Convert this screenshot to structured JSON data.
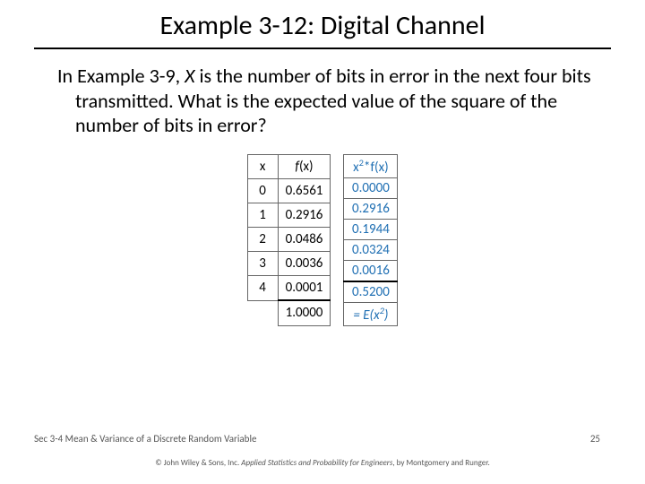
{
  "title": "Example 3-12:  Digital Channel",
  "body": {
    "lead": "In Example 3-9, ",
    "var": "X",
    "rest": " is the number of bits in error in the next four bits transmitted.  What is the expected value of the square of the number of bits in error?"
  },
  "table1": {
    "h1": "x",
    "h2_prefix": "f",
    "h2_suffix": "(x)",
    "rows": [
      {
        "x": "0",
        "fx": "0.6561"
      },
      {
        "x": "1",
        "fx": "0.2916"
      },
      {
        "x": "2",
        "fx": "0.0486"
      },
      {
        "x": "3",
        "fx": "0.0036"
      },
      {
        "x": "4",
        "fx": "0.0001"
      }
    ],
    "sum": "1.0000"
  },
  "table2": {
    "header": "x²*f(x)",
    "rows": [
      "0.0000",
      "0.2916",
      "0.1944",
      "0.0324",
      "0.0016"
    ],
    "sum": "0.5200",
    "eq": "= E(x²)"
  },
  "footer": {
    "section": "Sec 3-4 Mean & Variance of a Discrete Random Variable",
    "page": "25",
    "copyright_prefix": "© John Wiley & Sons, Inc.  ",
    "copyright_book": "Applied Statistics and Probability for Engineers",
    "copyright_suffix": ", by Montgomery and Runger."
  }
}
